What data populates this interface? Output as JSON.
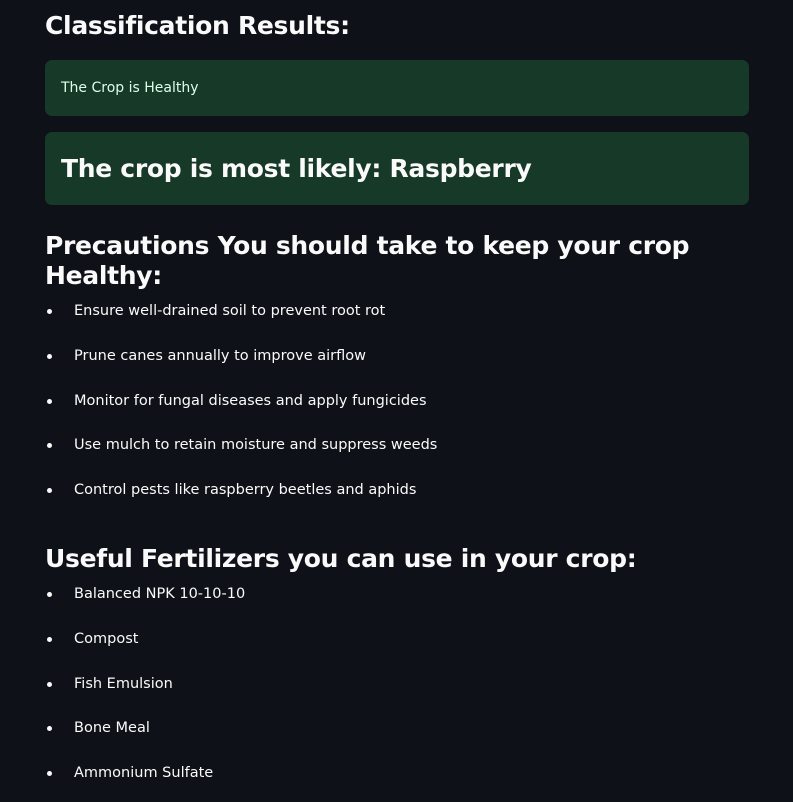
{
  "results": {
    "title": "Classification Results:",
    "status_text": "The Crop is Healthy",
    "crop_text": "The crop is most likely: Raspberry"
  },
  "precautions": {
    "title": "Precautions You should take to keep your crop Healthy:",
    "items": [
      "Ensure well-drained soil to prevent root rot",
      "Prune canes annually to improve airflow",
      "Monitor for fungal diseases and apply fungicides",
      "Use mulch to retain moisture and suppress weeds",
      "Control pests like raspberry beetles and aphids"
    ]
  },
  "fertilizers": {
    "title": "Useful Fertilizers you can use in your crop:",
    "items": [
      "Balanced NPK 10-10-10",
      "Compost",
      "Fish Emulsion",
      "Bone Meal",
      "Ammonium Sulfate"
    ]
  },
  "colors": {
    "background": "#0e1117",
    "success_alert_bg": "#173928",
    "success_alert_text": "#dffde9",
    "text": "#fafafa"
  }
}
